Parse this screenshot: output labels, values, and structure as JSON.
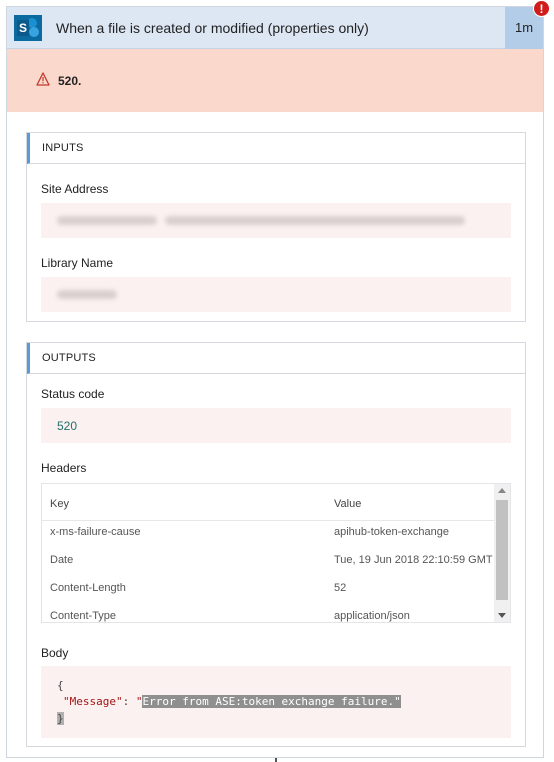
{
  "header": {
    "title": "When a file is created or modified (properties only)",
    "duration": "1m",
    "error_badge": "!"
  },
  "error": {
    "message": "520."
  },
  "inputs": {
    "section_label": "INPUTS",
    "site_address_label": "Site Address",
    "library_name_label": "Library Name"
  },
  "outputs": {
    "section_label": "OUTPUTS",
    "status_code_label": "Status code",
    "status_code_value": "520",
    "headers_label": "Headers",
    "headers_table": {
      "columns": [
        "Key",
        "Value"
      ],
      "rows": [
        [
          "x-ms-failure-cause",
          "apihub-token-exchange"
        ],
        [
          "Date",
          "Tue, 19 Jun 2018 22:10:59 GMT"
        ],
        [
          "Content-Length",
          "52"
        ],
        [
          "Content-Type",
          "application/json"
        ]
      ]
    },
    "body_label": "Body",
    "body": {
      "open_brace": "{",
      "key": "\"Message\"",
      "colon": ": ",
      "open_quote": "\"",
      "value": "Error from ASE:token exchange failure.",
      "close_quote": "\"",
      "close_brace": "}"
    }
  },
  "colors": {
    "header_bg": "#dde6f3",
    "duration_bg": "#b3cce8",
    "error_bg": "#fbd8cc",
    "field_bg": "#fbf1f0",
    "accent": "#5b9bd5",
    "badge": "#d11c1c",
    "sharepoint": "#0b6a9f"
  },
  "icons": {
    "app": "sharepoint-icon",
    "warning": "warning-icon",
    "error": "error-badge-icon"
  }
}
